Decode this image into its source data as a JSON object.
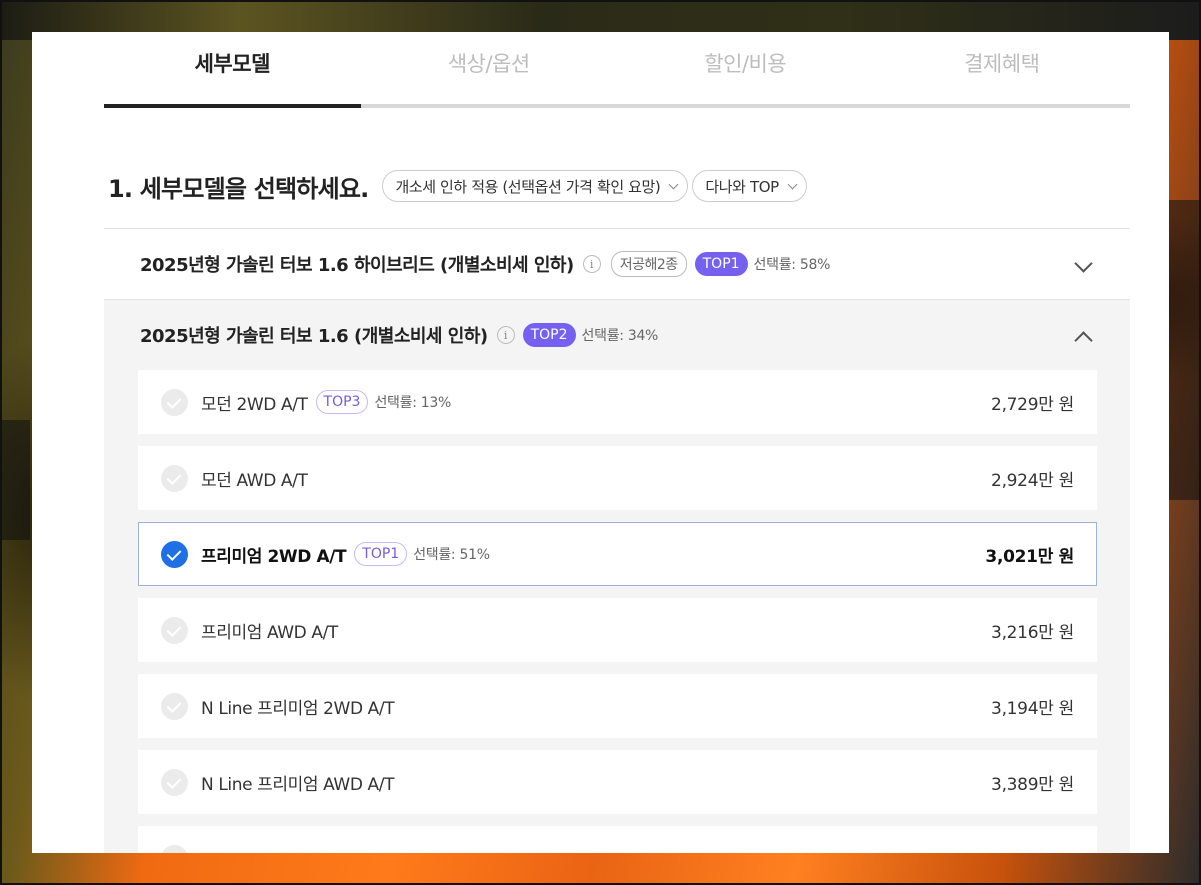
{
  "tabs": [
    {
      "label": "세부모델",
      "active": true
    },
    {
      "label": "색상/옵션",
      "active": false
    },
    {
      "label": "할인/비용",
      "active": false
    },
    {
      "label": "결제혜택",
      "active": false
    }
  ],
  "section": {
    "title": "1. 세부모델을 선택하세요.",
    "filter_label": "개소세 인하 적용 (선택옵션 가격 확인 요망)",
    "sort_label": "다나와 TOP"
  },
  "groups": [
    {
      "title": "2025년형 가솔린 터보 1.6 하이브리드 (개별소비세 인하)",
      "info_icon": "i",
      "tag": "저공해2종",
      "top": "TOP1",
      "rate": "선택률: 58%",
      "expanded": false
    },
    {
      "title": "2025년형 가솔린 터보 1.6 (개별소비세 인하)",
      "info_icon": "i",
      "top": "TOP2",
      "rate": "선택률: 34%",
      "expanded": true,
      "items": [
        {
          "name": "모던 2WD A/T",
          "top": "TOP3",
          "rate": "선택률: 13%",
          "price": "2,729만 원",
          "selected": false
        },
        {
          "name": "모던 AWD A/T",
          "price": "2,924만 원",
          "selected": false
        },
        {
          "name": "프리미엄 2WD A/T",
          "top": "TOP1",
          "rate": "선택률: 51%",
          "price": "3,021만 원",
          "selected": true
        },
        {
          "name": "프리미엄 AWD A/T",
          "price": "3,216만 원",
          "selected": false
        },
        {
          "name": "N Line 프리미엄 2WD A/T",
          "price": "3,194만 원",
          "selected": false
        },
        {
          "name": "N Line 프리미엄 AWD A/T",
          "price": "3,389만 원",
          "selected": false
        }
      ]
    }
  ]
}
